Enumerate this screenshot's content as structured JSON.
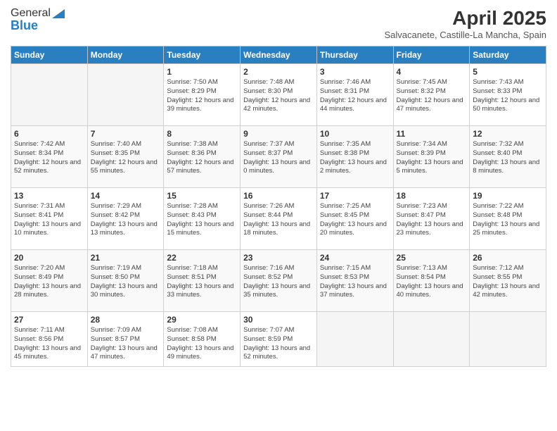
{
  "header": {
    "logo_general": "General",
    "logo_blue": "Blue",
    "month_title": "April 2025",
    "location": "Salvacanete, Castille-La Mancha, Spain"
  },
  "weekdays": [
    "Sunday",
    "Monday",
    "Tuesday",
    "Wednesday",
    "Thursday",
    "Friday",
    "Saturday"
  ],
  "weeks": [
    [
      {
        "day": "",
        "info": ""
      },
      {
        "day": "",
        "info": ""
      },
      {
        "day": "1",
        "info": "Sunrise: 7:50 AM\nSunset: 8:29 PM\nDaylight: 12 hours and 39 minutes."
      },
      {
        "day": "2",
        "info": "Sunrise: 7:48 AM\nSunset: 8:30 PM\nDaylight: 12 hours and 42 minutes."
      },
      {
        "day": "3",
        "info": "Sunrise: 7:46 AM\nSunset: 8:31 PM\nDaylight: 12 hours and 44 minutes."
      },
      {
        "day": "4",
        "info": "Sunrise: 7:45 AM\nSunset: 8:32 PM\nDaylight: 12 hours and 47 minutes."
      },
      {
        "day": "5",
        "info": "Sunrise: 7:43 AM\nSunset: 8:33 PM\nDaylight: 12 hours and 50 minutes."
      }
    ],
    [
      {
        "day": "6",
        "info": "Sunrise: 7:42 AM\nSunset: 8:34 PM\nDaylight: 12 hours and 52 minutes."
      },
      {
        "day": "7",
        "info": "Sunrise: 7:40 AM\nSunset: 8:35 PM\nDaylight: 12 hours and 55 minutes."
      },
      {
        "day": "8",
        "info": "Sunrise: 7:38 AM\nSunset: 8:36 PM\nDaylight: 12 hours and 57 minutes."
      },
      {
        "day": "9",
        "info": "Sunrise: 7:37 AM\nSunset: 8:37 PM\nDaylight: 13 hours and 0 minutes."
      },
      {
        "day": "10",
        "info": "Sunrise: 7:35 AM\nSunset: 8:38 PM\nDaylight: 13 hours and 2 minutes."
      },
      {
        "day": "11",
        "info": "Sunrise: 7:34 AM\nSunset: 8:39 PM\nDaylight: 13 hours and 5 minutes."
      },
      {
        "day": "12",
        "info": "Sunrise: 7:32 AM\nSunset: 8:40 PM\nDaylight: 13 hours and 8 minutes."
      }
    ],
    [
      {
        "day": "13",
        "info": "Sunrise: 7:31 AM\nSunset: 8:41 PM\nDaylight: 13 hours and 10 minutes."
      },
      {
        "day": "14",
        "info": "Sunrise: 7:29 AM\nSunset: 8:42 PM\nDaylight: 13 hours and 13 minutes."
      },
      {
        "day": "15",
        "info": "Sunrise: 7:28 AM\nSunset: 8:43 PM\nDaylight: 13 hours and 15 minutes."
      },
      {
        "day": "16",
        "info": "Sunrise: 7:26 AM\nSunset: 8:44 PM\nDaylight: 13 hours and 18 minutes."
      },
      {
        "day": "17",
        "info": "Sunrise: 7:25 AM\nSunset: 8:45 PM\nDaylight: 13 hours and 20 minutes."
      },
      {
        "day": "18",
        "info": "Sunrise: 7:23 AM\nSunset: 8:47 PM\nDaylight: 13 hours and 23 minutes."
      },
      {
        "day": "19",
        "info": "Sunrise: 7:22 AM\nSunset: 8:48 PM\nDaylight: 13 hours and 25 minutes."
      }
    ],
    [
      {
        "day": "20",
        "info": "Sunrise: 7:20 AM\nSunset: 8:49 PM\nDaylight: 13 hours and 28 minutes."
      },
      {
        "day": "21",
        "info": "Sunrise: 7:19 AM\nSunset: 8:50 PM\nDaylight: 13 hours and 30 minutes."
      },
      {
        "day": "22",
        "info": "Sunrise: 7:18 AM\nSunset: 8:51 PM\nDaylight: 13 hours and 33 minutes."
      },
      {
        "day": "23",
        "info": "Sunrise: 7:16 AM\nSunset: 8:52 PM\nDaylight: 13 hours and 35 minutes."
      },
      {
        "day": "24",
        "info": "Sunrise: 7:15 AM\nSunset: 8:53 PM\nDaylight: 13 hours and 37 minutes."
      },
      {
        "day": "25",
        "info": "Sunrise: 7:13 AM\nSunset: 8:54 PM\nDaylight: 13 hours and 40 minutes."
      },
      {
        "day": "26",
        "info": "Sunrise: 7:12 AM\nSunset: 8:55 PM\nDaylight: 13 hours and 42 minutes."
      }
    ],
    [
      {
        "day": "27",
        "info": "Sunrise: 7:11 AM\nSunset: 8:56 PM\nDaylight: 13 hours and 45 minutes."
      },
      {
        "day": "28",
        "info": "Sunrise: 7:09 AM\nSunset: 8:57 PM\nDaylight: 13 hours and 47 minutes."
      },
      {
        "day": "29",
        "info": "Sunrise: 7:08 AM\nSunset: 8:58 PM\nDaylight: 13 hours and 49 minutes."
      },
      {
        "day": "30",
        "info": "Sunrise: 7:07 AM\nSunset: 8:59 PM\nDaylight: 13 hours and 52 minutes."
      },
      {
        "day": "",
        "info": ""
      },
      {
        "day": "",
        "info": ""
      },
      {
        "day": "",
        "info": ""
      }
    ]
  ]
}
